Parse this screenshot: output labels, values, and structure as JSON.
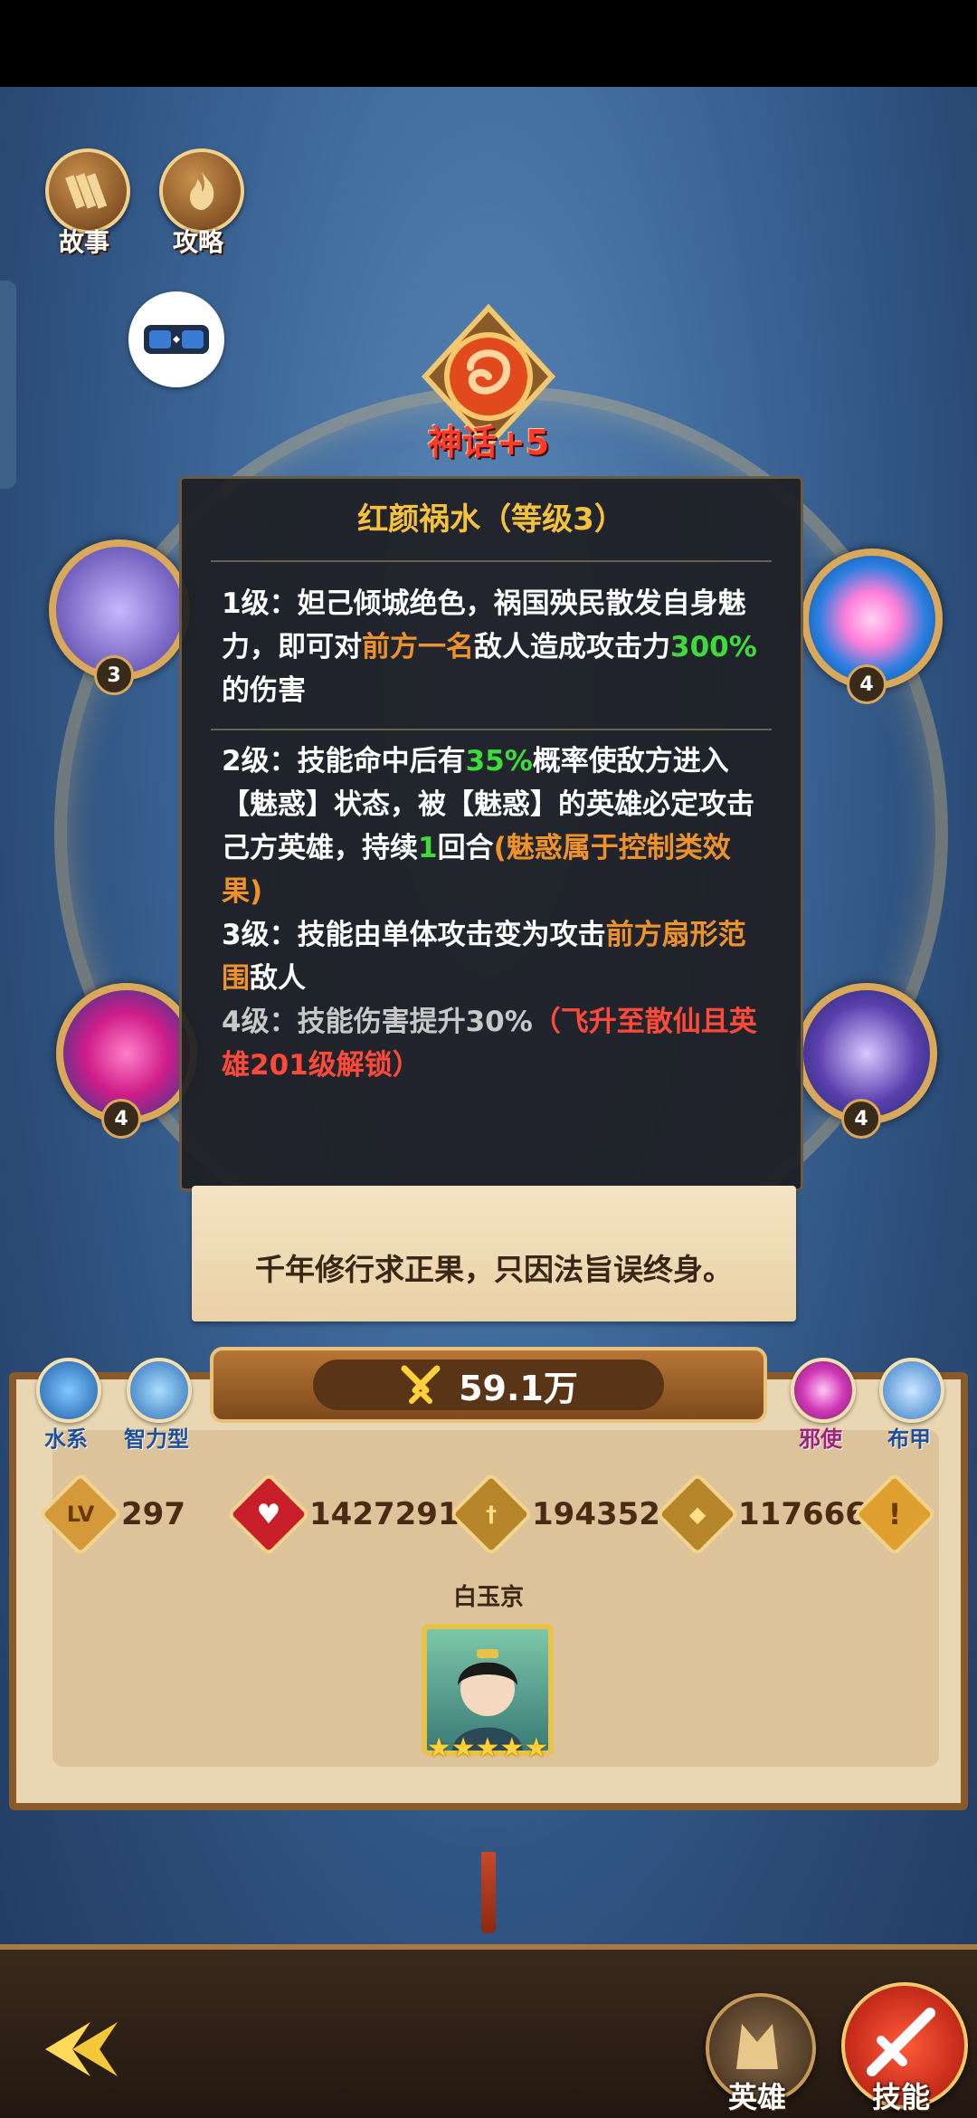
{
  "top_buttons": {
    "story_label": "故事",
    "guide_label": "攻略"
  },
  "hero": {
    "rank_label": "神话+5"
  },
  "skill_orbs": {
    "left_top_level": "3",
    "right_top_level": "4",
    "left_bottom_level": "4",
    "right_bottom_level": "4"
  },
  "tooltip": {
    "title": "红颜祸水（等级3）",
    "level1_a": "1级：妲己倾城绝色，祸国殃民散发自身魅力，即可对",
    "level1_target": "前方一名",
    "level1_b": "敌人造成攻击力",
    "level1_pct": "300%",
    "level1_c": "的伤害",
    "level2_a": "2级：技能命中后有",
    "level2_pct": "35%",
    "level2_b": "概率使敌方进入【魅惑】状态，被【魅惑】的英雄必定攻击己方英雄，持续",
    "level2_turns": "1",
    "level2_c": "回合",
    "level2_note": "(魅惑属于控制类效果)",
    "level3_a": "3级：技能由单体攻击变为攻击",
    "level3_hl": "前方扇形范围",
    "level3_b": "敌人",
    "level4_a": "4级：技能伤害提升30%",
    "level4_lock": "（飞升至散仙且英雄201级解锁）"
  },
  "quote": "千年修行求正果，只因法旨误终身。",
  "power": {
    "value": "59.1万"
  },
  "tags": {
    "element": "水系",
    "type": "智力型",
    "faction": "邪使",
    "armor": "布甲"
  },
  "stats": {
    "level_icon_text": "LV",
    "level": "297",
    "hp": "1427291",
    "attack": "194352",
    "defense": "117666",
    "info_icon_text": "!"
  },
  "owner": {
    "name": "白玉京",
    "stars": "★★★★★"
  },
  "bottom_nav": {
    "hero_label": "英雄",
    "skill_label": "技能"
  },
  "colors": {
    "title_gold": "#f6c23c",
    "highlight_orange": "#f0922a",
    "highlight_green": "#3ddc3a",
    "highlight_red": "#ff4a3a"
  }
}
